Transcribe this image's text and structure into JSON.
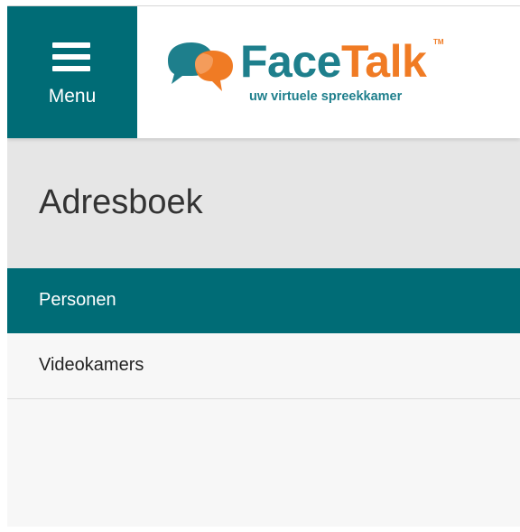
{
  "header": {
    "menu_label": "Menu",
    "logo": {
      "face": "Face",
      "talk": "Talk",
      "trademark": "TM",
      "tagline": "uw virtuele spreekkamer",
      "icon": "speech-bubbles-logo-icon",
      "colors": {
        "teal": "#1e7f8c",
        "orange": "#f07b24"
      }
    }
  },
  "page": {
    "title": "Adresboek"
  },
  "nav": {
    "items": [
      {
        "label": "Personen",
        "active": true
      },
      {
        "label": "Videokamers",
        "active": false
      }
    ]
  },
  "colors": {
    "primary": "#006c76",
    "title_bar": "#e6e6e6",
    "background": "#f7f7f7"
  }
}
